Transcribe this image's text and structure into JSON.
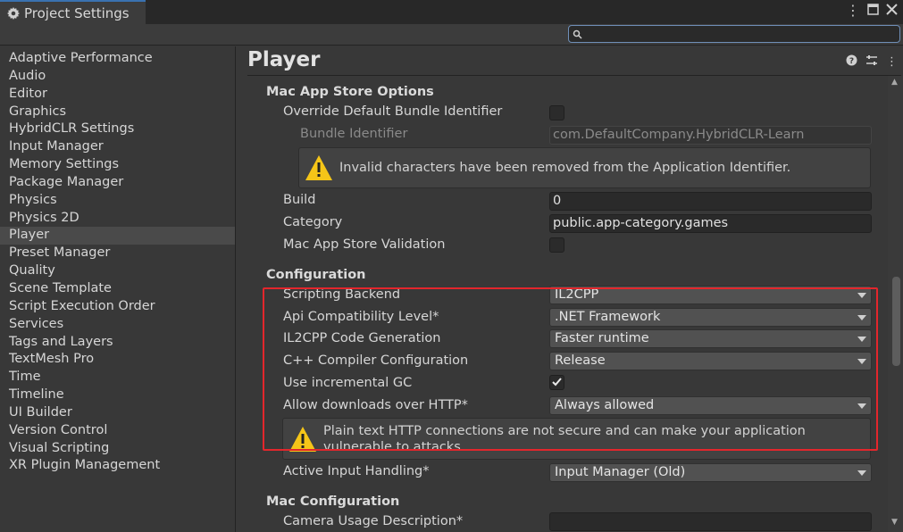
{
  "window": {
    "tab_title": "Project Settings",
    "tab_icon": "gear-icon",
    "controls": [
      "kebab-menu-icon",
      "maximize-icon",
      "close-icon"
    ]
  },
  "search": {
    "placeholder": "",
    "value": ""
  },
  "sidebar": {
    "items": [
      {
        "label": "Adaptive Performance"
      },
      {
        "label": "Audio"
      },
      {
        "label": "Editor"
      },
      {
        "label": "Graphics"
      },
      {
        "label": "HybridCLR Settings"
      },
      {
        "label": "Input Manager"
      },
      {
        "label": "Memory Settings"
      },
      {
        "label": "Package Manager"
      },
      {
        "label": "Physics"
      },
      {
        "label": "Physics 2D"
      },
      {
        "label": "Player",
        "selected": true
      },
      {
        "label": "Preset Manager"
      },
      {
        "label": "Quality"
      },
      {
        "label": "Scene Template"
      },
      {
        "label": "Script Execution Order"
      },
      {
        "label": "Services"
      },
      {
        "label": "Tags and Layers"
      },
      {
        "label": "TextMesh Pro"
      },
      {
        "label": "Time"
      },
      {
        "label": "Timeline"
      },
      {
        "label": "UI Builder"
      },
      {
        "label": "Version Control"
      },
      {
        "label": "Visual Scripting"
      },
      {
        "label": "XR Plugin Management"
      }
    ]
  },
  "main": {
    "title": "Player",
    "header_icons": [
      "help-icon",
      "presets-icon",
      "more-icon"
    ],
    "mac_app_store": {
      "heading": "Mac App Store Options",
      "override_label": "Override Default Bundle Identifier",
      "override_checked": false,
      "bundle_id_label": "Bundle Identifier",
      "bundle_id_value": "com.DefaultCompany.HybridCLR-Learn",
      "bundle_warning": "Invalid characters have been removed from the Application Identifier.",
      "build_label": "Build",
      "build_value": "0",
      "category_label": "Category",
      "category_value": "public.app-category.games",
      "validation_label": "Mac App Store Validation",
      "validation_checked": false
    },
    "configuration": {
      "heading": "Configuration",
      "scripting_backend_label": "Scripting Backend",
      "scripting_backend_value": "IL2CPP",
      "api_level_label": "Api Compatibility Level*",
      "api_level_value": ".NET Framework",
      "codegen_label": "IL2CPP Code Generation",
      "codegen_value": "Faster runtime",
      "cpp_config_label": "C++ Compiler Configuration",
      "cpp_config_value": "Release",
      "incremental_gc_label": "Use incremental GC",
      "incremental_gc_checked": true,
      "http_label": "Allow downloads over HTTP*",
      "http_value": "Always allowed",
      "http_warning_line1": "Plain text HTTP connections are not secure and can make your application",
      "http_warning_line2": "vulnerable to attacks.",
      "input_handling_label": "Active Input Handling*",
      "input_handling_value": "Input Manager (Old)"
    },
    "mac_configuration": {
      "heading": "Mac Configuration",
      "camera_usage_label": "Camera Usage Description*",
      "camera_usage_value": ""
    }
  },
  "colors": {
    "highlight_box": "#e3262c",
    "warning_icon": "#f5c518",
    "tab_accent": "#3a72b0"
  }
}
